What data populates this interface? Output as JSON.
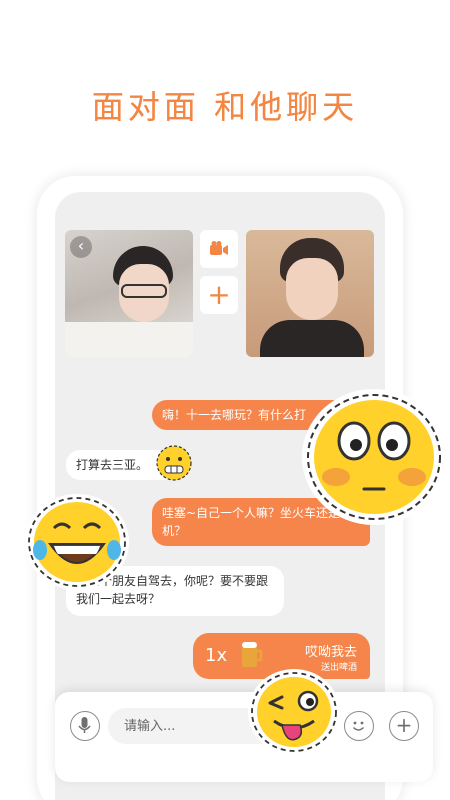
{
  "headline": "面对面 和他聊天",
  "chat": {
    "m1": "嗨！十一去哪玩？有什么打",
    "m2": "打算去三亚。",
    "m3": "哇塞~自己一个人嘛？坐火车还是飞机？",
    "m4": "和几个朋友自驾去，你呢？要不要跟我们一起去呀？"
  },
  "gift": {
    "count": "1x",
    "name": "哎呦我去",
    "desc": "送出啤酒"
  },
  "input": {
    "placeholder": "请输入..."
  },
  "icons": {
    "back": "back-arrow-icon",
    "video": "video-camera-icon",
    "add": "plus-icon",
    "mic": "microphone-icon",
    "emoji": "emoji-icon"
  },
  "colors": {
    "accent": "#f5854a",
    "headline": "#f28642",
    "sticker_yellow": "#ffd12a"
  }
}
